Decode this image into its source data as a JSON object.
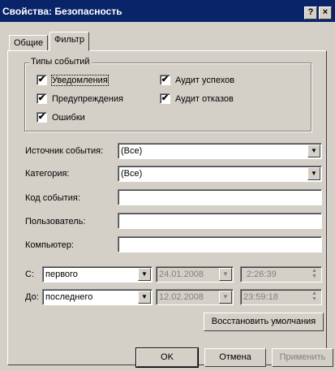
{
  "window": {
    "title": "Свойства: Безопасность",
    "help_btn": "?",
    "close_btn": "×"
  },
  "tabs": [
    {
      "label": "Общие",
      "active": false
    },
    {
      "label": "Фильтр",
      "active": true
    }
  ],
  "event_types": {
    "group_label": "Типы событий",
    "items": [
      {
        "label": "Уведомления",
        "checked": true
      },
      {
        "label": "Предупреждения",
        "checked": true
      },
      {
        "label": "Ошибки",
        "checked": true
      },
      {
        "label": "Аудит успехов",
        "checked": true
      },
      {
        "label": "Аудит отказов",
        "checked": true
      }
    ],
    "check_mark": "✔"
  },
  "fields": {
    "source": {
      "label": "Источник события:",
      "value": "(Все)"
    },
    "category": {
      "label": "Категория:",
      "value": "(Все)"
    },
    "event_id": {
      "label": "Код события:",
      "value": ""
    },
    "user": {
      "label": "Пользователь:",
      "value": ""
    },
    "computer": {
      "label": "Компьютер:",
      "value": ""
    }
  },
  "range": {
    "from": {
      "label": "С:",
      "select": "первого",
      "date": "24.01.2008",
      "time": "2:26:39"
    },
    "to": {
      "label": "До:",
      "select": "последнего",
      "date": "12.02.2008",
      "time": "23:59:18"
    }
  },
  "buttons": {
    "restore_defaults": "Восстановить умолчания",
    "ok": "OK",
    "cancel": "Отмена",
    "apply": "Применить"
  },
  "icons": {
    "dropdown_arrow": "▼",
    "spin_up": "▲",
    "spin_down": "▼"
  }
}
